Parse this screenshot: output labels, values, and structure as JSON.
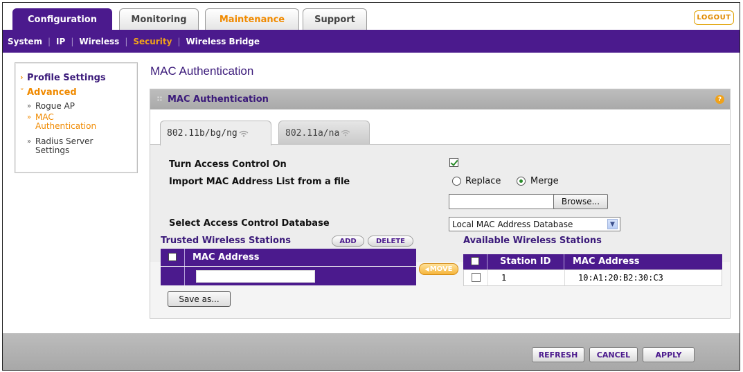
{
  "main_tabs": [
    {
      "label": "Configuration",
      "active": true
    },
    {
      "label": "Monitoring",
      "active": false
    },
    {
      "label": "Maintenance",
      "active": false
    },
    {
      "label": "Support",
      "active": false
    }
  ],
  "logout_label": "LOGOUT",
  "subnav": [
    {
      "label": "System",
      "active": false
    },
    {
      "label": "IP",
      "active": false
    },
    {
      "label": "Wireless",
      "active": false
    },
    {
      "label": "Security",
      "active": true
    },
    {
      "label": "Wireless Bridge",
      "active": false
    }
  ],
  "sidebar": {
    "profile_settings": "Profile Settings",
    "advanced": "Advanced",
    "items": [
      {
        "label": "Rogue AP",
        "active": false
      },
      {
        "label": "MAC Authentication",
        "active": true
      },
      {
        "label": "Radius Server Settings",
        "active": false
      }
    ]
  },
  "page_title": "MAC Authentication",
  "panel": {
    "title": "MAC Authentication",
    "help": "?"
  },
  "radio_tabs": [
    {
      "label": "802.11b/bg/ng",
      "active": true
    },
    {
      "label": "802.11a/na",
      "active": false
    }
  ],
  "form": {
    "access_control_label": "Turn Access Control On",
    "access_control_on": true,
    "import_label": "Import MAC Address List from a file",
    "replace_label": "Replace",
    "merge_label": "Merge",
    "import_mode": "Merge",
    "file_value": "",
    "browse_label": "Browse...",
    "database_label": "Select Access Control Database",
    "database_value": "Local MAC Address Database"
  },
  "trusted": {
    "title": "Trusted Wireless Stations",
    "add_label": "ADD",
    "delete_label": "DELETE",
    "header": "MAC Address",
    "new_mac_value": "",
    "save_as_label": "Save as..."
  },
  "move_label": "MOVE",
  "available": {
    "title": "Available Wireless Stations",
    "headers": [
      "Station ID",
      "MAC Address"
    ],
    "rows": [
      {
        "station_id": "1",
        "mac": "10:A1:20:B2:30:C3",
        "checked": false
      }
    ]
  },
  "footer": {
    "refresh_label": "REFRESH",
    "cancel_label": "CANCEL",
    "apply_label": "APPLY"
  },
  "colors": {
    "brand_purple": "#4b1a8d",
    "accent_orange": "#f08a00",
    "check_green": "#2a8c2a"
  }
}
